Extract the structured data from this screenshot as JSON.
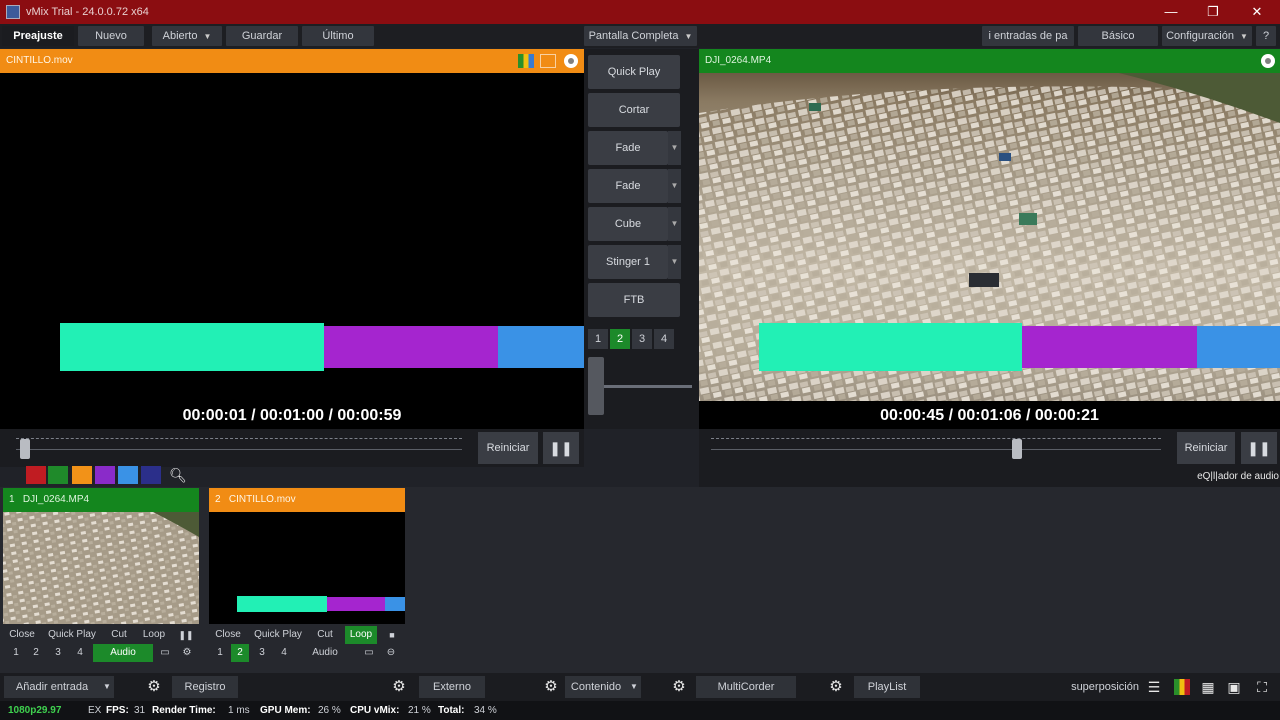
{
  "window": {
    "title": "vMix Trial - 24.0.0.72 x64",
    "minimize_glyph": "—",
    "maximize_glyph": "❐",
    "close_glyph": "✕"
  },
  "toolbar": {
    "tabs": [
      "Preajuste",
      "Nuevo",
      "Abierto",
      "Guardar",
      "Último"
    ],
    "fullscreen": "Pantalla Completa",
    "inputs_per_page": "i entradas de pa",
    "basic": "Básico",
    "settings": "Configuración",
    "help": "?"
  },
  "preview": {
    "name": "CINTILLO.mov",
    "timecode": "00:00:01  /  00:01:00  /  00:00:59",
    "restart": "Reiniciar",
    "pause": "❚❚",
    "seek_fraction": 0.02
  },
  "output": {
    "name": "DJI_0264.MP4",
    "timecode": "00:00:45  /  00:01:06  /  00:00:21",
    "restart": "Reiniciar",
    "pause": "❚❚",
    "seek_fraction": 0.68,
    "audio_mixer": "eQ|l|ador de audio"
  },
  "transitions": {
    "quick_play": "Quick Play",
    "cut": "Cortar",
    "items": [
      "Fade",
      "Fade",
      "Cube",
      "Stinger 1"
    ],
    "ftb": "FTB",
    "numbers": [
      "1",
      "2",
      "3",
      "4"
    ],
    "active_number": "2"
  },
  "lower_third_colors": {
    "teal": "#22f0b5",
    "purple": "#a525cf",
    "blue": "#3a92e6"
  },
  "color_tags": [
    "#c01c22",
    "#1f8a2a",
    "#f29218",
    "#8a2bc9",
    "#3a92e6",
    "#2b2f8a"
  ],
  "inputs": [
    {
      "number": "1",
      "name": "DJI_0264.MP4",
      "head_color": "#14861e",
      "controls": [
        "Close",
        "Quick Play",
        "Cut",
        "Loop",
        "❚❚"
      ],
      "pages": [
        "1",
        "2",
        "3",
        "4"
      ],
      "audio": "Audio",
      "active_page": "",
      "loop_on": false,
      "audio_on": true
    },
    {
      "number": "2",
      "name": "CINTILLO.mov",
      "head_color": "#f18c14",
      "controls": [
        "Close",
        "Quick Play",
        "Cut",
        "Loop",
        "■"
      ],
      "pages": [
        "1",
        "2",
        "3",
        "4"
      ],
      "audio": "Audio",
      "active_page": "2",
      "loop_on": true,
      "audio_on": false
    }
  ],
  "bottom": {
    "add_input": "Añadir entrada",
    "records": "Registro",
    "external": "Externo",
    "content": "Contenido",
    "multicorder": "MultiCorder",
    "playlist": "PlayList",
    "overlay": "superposición"
  },
  "status": {
    "format": "1080p29.97",
    "ex": "EX",
    "fps_label": "FPS:",
    "fps": "31",
    "render_label": "Render Time:",
    "render": "1 ms",
    "gpu_label": "GPU Mem:",
    "gpu": "26 %",
    "cpu_label": "CPU vMix:",
    "cpu": "21 %",
    "total_label": "Total:",
    "total": "34 %"
  }
}
